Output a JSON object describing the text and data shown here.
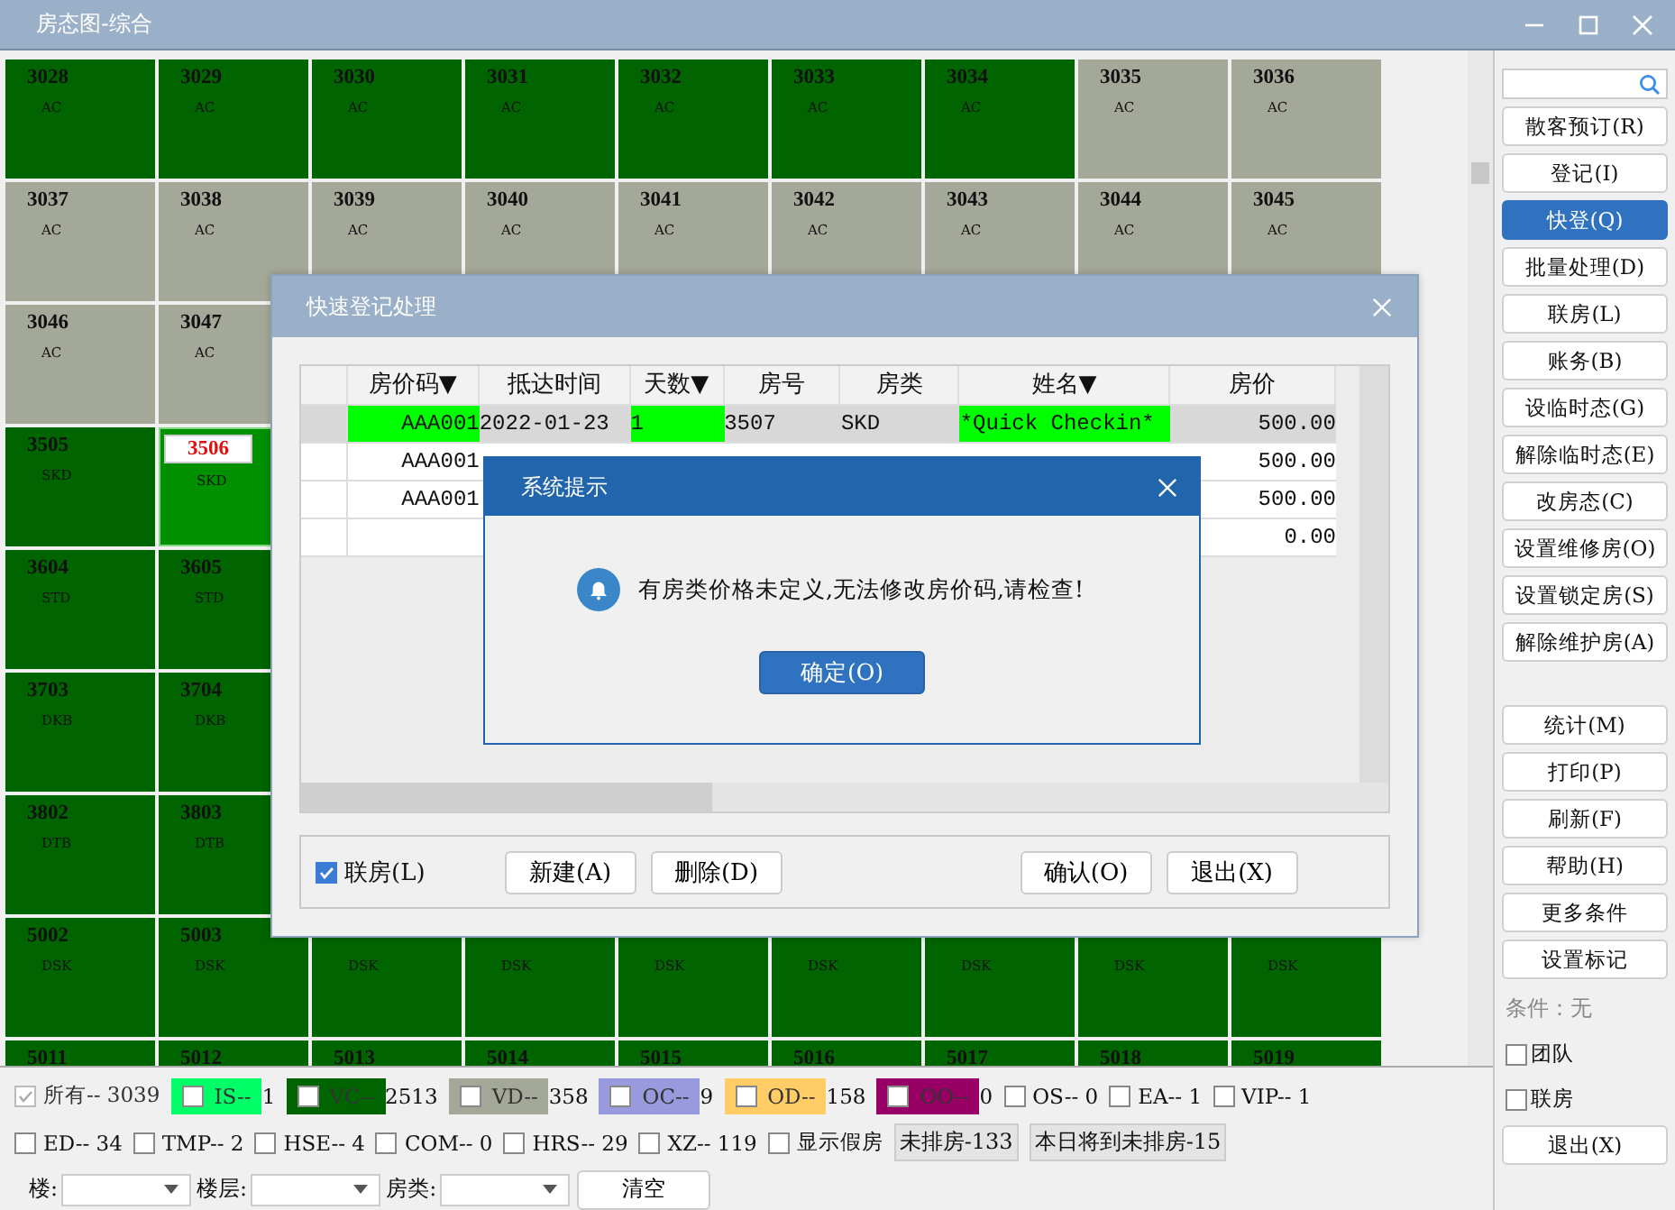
{
  "window": {
    "title": "房态图-综合"
  },
  "room_rows": [
    {
      "rooms": [
        {
          "number": "3028",
          "type": "AC",
          "color": "#006400",
          "selected": false
        },
        {
          "number": "3029",
          "type": "AC",
          "color": "#006400",
          "selected": false
        },
        {
          "number": "3030",
          "type": "AC",
          "color": "#006400",
          "selected": false
        },
        {
          "number": "3031",
          "type": "AC",
          "color": "#006400",
          "selected": false
        },
        {
          "number": "3032",
          "type": "AC",
          "color": "#006400",
          "selected": false
        },
        {
          "number": "3033",
          "type": "AC",
          "color": "#006400",
          "selected": false
        },
        {
          "number": "3034",
          "type": "AC",
          "color": "#006400",
          "selected": false
        },
        {
          "number": "3035",
          "type": "AC",
          "color": "#a4a898",
          "selected": false
        },
        {
          "number": "3036",
          "type": "AC",
          "color": "#a4a898",
          "selected": false
        }
      ]
    },
    {
      "rooms": [
        {
          "number": "3037",
          "type": "AC",
          "color": "#a4a898",
          "selected": false
        },
        {
          "number": "3038",
          "type": "AC",
          "color": "#a4a898",
          "selected": false
        },
        {
          "number": "3039",
          "type": "AC",
          "color": "#a4a898",
          "selected": false
        },
        {
          "number": "3040",
          "type": "AC",
          "color": "#a4a898",
          "selected": false
        },
        {
          "number": "3041",
          "type": "AC",
          "color": "#a4a898",
          "selected": false
        },
        {
          "number": "3042",
          "type": "AC",
          "color": "#a4a898",
          "selected": false
        },
        {
          "number": "3043",
          "type": "AC",
          "color": "#a4a898",
          "selected": false
        },
        {
          "number": "3044",
          "type": "AC",
          "color": "#a4a898",
          "selected": false
        },
        {
          "number": "3045",
          "type": "AC",
          "color": "#a4a898",
          "selected": false
        }
      ]
    },
    {
      "rooms": [
        {
          "number": "3046",
          "type": "AC",
          "color": "#a4a898",
          "selected": false
        },
        {
          "number": "3047",
          "type": "AC",
          "color": "#a4a898",
          "selected": false
        }
      ]
    },
    {
      "rooms": [
        {
          "number": "3505",
          "type": "SKD",
          "color": "#006400",
          "selected": false
        },
        {
          "number": "3506",
          "type": "SKD",
          "color": "#009000",
          "selected": true
        }
      ]
    },
    {
      "rooms": [
        {
          "number": "3604",
          "type": "STD",
          "color": "#006400",
          "selected": false
        },
        {
          "number": "3605",
          "type": "STD",
          "color": "#006400",
          "selected": false
        }
      ]
    },
    {
      "rooms": [
        {
          "number": "3703",
          "type": "DKB",
          "color": "#006400",
          "selected": false
        },
        {
          "number": "3704",
          "type": "DKB",
          "color": "#006400",
          "selected": false
        }
      ]
    },
    {
      "rooms": [
        {
          "number": "3802",
          "type": "DTB",
          "color": "#006400",
          "selected": false
        },
        {
          "number": "3803",
          "type": "DTB",
          "color": "#006400",
          "selected": false
        }
      ]
    },
    {
      "rooms": [
        {
          "number": "5002",
          "type": "DSK",
          "color": "#006400",
          "selected": false
        },
        {
          "number": "5003",
          "type": "DSK",
          "color": "#006400",
          "selected": false
        },
        {
          "type": "DSK",
          "color": "#006400",
          "selected": false
        },
        {
          "type": "DSK",
          "color": "#006400",
          "selected": false
        },
        {
          "type": "DSK",
          "color": "#006400",
          "selected": false
        },
        {
          "type": "DSK",
          "color": "#006400",
          "selected": false
        },
        {
          "type": "DSK",
          "color": "#006400",
          "selected": false
        },
        {
          "type": "DSK",
          "color": "#006400",
          "selected": false
        },
        {
          "type": "DSK",
          "color": "#006400",
          "selected": false
        }
      ]
    },
    {
      "rooms": [
        {
          "number": "5011",
          "color": "#006400",
          "selected": false
        },
        {
          "number": "5012",
          "color": "#006400",
          "selected": false
        },
        {
          "number": "5013",
          "color": "#006400",
          "selected": false
        },
        {
          "number": "5014",
          "color": "#006400",
          "selected": false
        },
        {
          "number": "5015",
          "color": "#006400",
          "selected": false
        },
        {
          "number": "5016",
          "color": "#006400",
          "selected": false
        },
        {
          "number": "5017",
          "color": "#006400",
          "selected": false
        },
        {
          "number": "5018",
          "color": "#006400",
          "selected": false
        },
        {
          "number": "5019",
          "color": "#006400",
          "selected": false
        }
      ]
    }
  ],
  "legend": [
    {
      "kind": "all",
      "label": "所有-- 3039",
      "checked": true,
      "disabled": true
    },
    {
      "kind": "colored",
      "label": "IS--",
      "count": "1",
      "color": "#00ff66",
      "checked": false
    },
    {
      "kind": "colored",
      "label": "VC--",
      "count": "2513",
      "color": "#006400",
      "checked": false
    },
    {
      "kind": "colored",
      "label": "VD--",
      "count": "358",
      "color": "#a4a898",
      "checked": false
    },
    {
      "kind": "colored",
      "label": "OC--",
      "count": "9",
      "color": "#9999dd",
      "checked": false
    },
    {
      "kind": "colored",
      "label": "OD--",
      "count": "158",
      "color": "#ffcc66",
      "checked": false
    },
    {
      "kind": "colored",
      "label": "OO--",
      "count": "0",
      "color": "#990066",
      "checked": false
    },
    {
      "kind": "plain",
      "label": "OS-- 0",
      "checked": false
    },
    {
      "kind": "plain",
      "label": "EA-- 1",
      "checked": false
    },
    {
      "kind": "plain",
      "label": "VIP-- 1",
      "checked": false
    }
  ],
  "flags": [
    {
      "label": "ED-- 34",
      "checked": false
    },
    {
      "label": "TMP-- 2",
      "checked": false
    },
    {
      "label": "HSE-- 4",
      "checked": false
    },
    {
      "label": "COM-- 0",
      "checked": false
    },
    {
      "label": "HRS-- 29",
      "checked": false
    },
    {
      "label": "XZ-- 119",
      "checked": false
    },
    {
      "label": "显示假房",
      "checked": false
    }
  ],
  "counters": [
    "未排房-133",
    "本日将到未排房-15"
  ],
  "filters": [
    {
      "label": "楼:"
    },
    {
      "label": "楼层:"
    },
    {
      "label": "房类:"
    }
  ],
  "clear_button": "清空",
  "sidebar": {
    "actions": [
      {
        "label": "散客预订(R)",
        "selected": false
      },
      {
        "label": "登记(I)",
        "selected": false
      },
      {
        "label": "快登(Q)",
        "selected": true
      },
      {
        "label": "批量处理(D)",
        "selected": false
      },
      {
        "label": "联房(L)",
        "selected": false
      },
      {
        "label": "账务(B)",
        "selected": false
      },
      {
        "label": "设临时态(G)",
        "selected": false
      },
      {
        "label": "解除临时态(E)",
        "selected": false
      },
      {
        "label": "改房态(C)",
        "selected": false
      },
      {
        "label": "设置维修房(O)",
        "selected": false
      },
      {
        "label": "设置锁定房(S)",
        "selected": false
      },
      {
        "label": "解除维护房(A)",
        "selected": false
      }
    ],
    "tools": [
      "统计(M)",
      "打印(P)",
      "刷新(F)",
      "帮助(H)",
      "更多条件",
      "设置标记"
    ],
    "condition": "条件：无",
    "options": [
      {
        "label": "团队",
        "checked": false
      },
      {
        "label": "联房",
        "checked": false
      }
    ],
    "exit_button": "退出(X)"
  },
  "quick_dialog": {
    "title": "快速登记处理",
    "columns": [
      "房价码▼",
      "抵达时间",
      "天数▼",
      "房号",
      "房类",
      "姓名▼",
      "房价"
    ],
    "rows": [
      {
        "selected": true,
        "cells": [
          {
            "text": "AAA001",
            "highlight": true
          },
          {
            "text": "2022-01-23",
            "highlight": false
          },
          {
            "text": "1",
            "highlight": true
          },
          {
            "text": "3507",
            "highlight": false
          },
          {
            "text": "SKD",
            "highlight": false
          },
          {
            "text": "*Quick Checkin*",
            "highlight": true
          }
        ],
        "price": "500.00"
      },
      {
        "selected": false,
        "cells": [
          {
            "text": "AAA001",
            "highlight": false
          }
        ],
        "price": "500.00"
      },
      {
        "selected": false,
        "cells": [
          {
            "text": "AAA001",
            "highlight": false
          }
        ],
        "price": "500.00"
      },
      {
        "selected": false,
        "price": "0.00"
      }
    ],
    "link_checkbox": {
      "label": "联房(L)",
      "checked": true
    },
    "buttons": [
      "新建(A)",
      "删除(D)",
      "确认(O)",
      "退出(X)"
    ]
  },
  "alert": {
    "title": "系统提示",
    "message": "有房类价格未定义,无法修改房价码,请检查!",
    "button": "确定(O)"
  }
}
